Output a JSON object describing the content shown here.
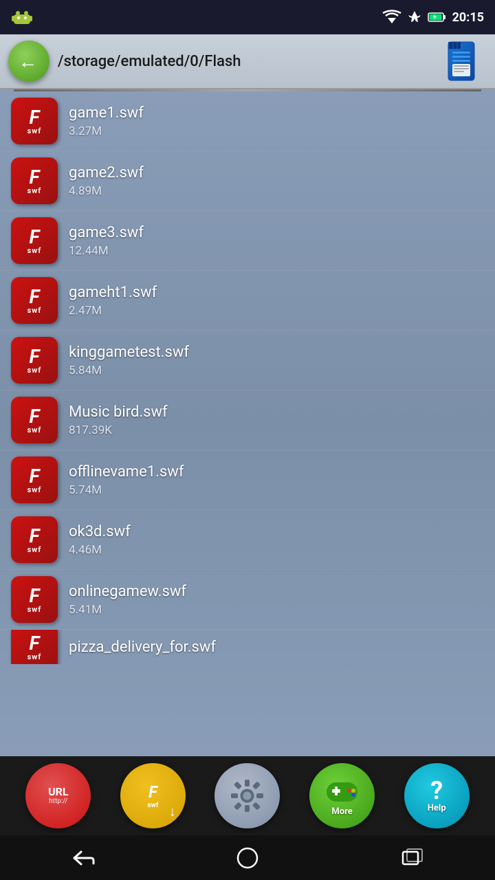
{
  "statusBar": {
    "time": "20:15",
    "wifiIcon": "wifi-icon",
    "airplaneIcon": "airplane-icon",
    "batteryIcon": "battery-icon"
  },
  "header": {
    "backLabel": "←",
    "path": "/storage/emulated/0/Flash",
    "sdCardIcon": "sd-card-icon"
  },
  "files": [
    {
      "name": "game1.swf",
      "size": "3.27M"
    },
    {
      "name": "game2.swf",
      "size": "4.89M"
    },
    {
      "name": "game3.swf",
      "size": "12.44M"
    },
    {
      "name": "gameht1.swf",
      "size": "2.47M"
    },
    {
      "name": "kinggametest.swf",
      "size": "5.84M"
    },
    {
      "name": "Music bird.swf",
      "size": "817.39K"
    },
    {
      "name": "offlinevame1.swf",
      "size": "5.74M"
    },
    {
      "name": "ok3d.swf",
      "size": "4.46M"
    },
    {
      "name": "onlinegamew.swf",
      "size": "5.41M"
    },
    {
      "name": "pizza_delivery_for.swf",
      "size": ""
    }
  ],
  "bottomNav": {
    "urlLabel": "URL",
    "urlSub": "http://",
    "flashLabel": "F swf",
    "settingsLabel": "Settings",
    "moreLabel": "More",
    "helpLabel": "Help"
  },
  "systemNav": {
    "backIcon": "system-back-icon",
    "homeIcon": "system-home-icon",
    "recentIcon": "system-recent-icon"
  }
}
